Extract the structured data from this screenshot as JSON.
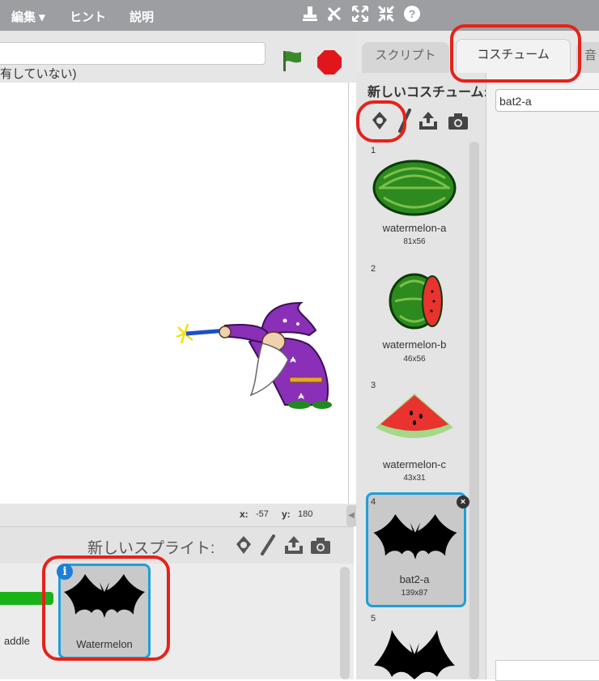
{
  "menubar": {
    "edit_label": "編集 ▾",
    "hint_label": "ヒント",
    "about_label": "説明"
  },
  "stage": {
    "sharing_note": "有していない)",
    "coords": {
      "x_label": "x:",
      "x_value": "-57",
      "y_label": "y:",
      "y_value": "180"
    }
  },
  "sprite_pane": {
    "new_sprite_label": "新しいスプライト:",
    "sprites": [
      {
        "label": "addle"
      },
      {
        "label": "Watermelon"
      }
    ]
  },
  "tabs": {
    "script": "スクリプト",
    "costume": "コスチューム",
    "sound": "音"
  },
  "costumes": {
    "new_costume_label": "新しいコスチューム:",
    "name_field_value": "bat2-a",
    "items": [
      {
        "number": "1",
        "name": "watermelon-a",
        "size": "81x56"
      },
      {
        "number": "2",
        "name": "watermelon-b",
        "size": "46x56"
      },
      {
        "number": "3",
        "name": "watermelon-c",
        "size": "43x31"
      },
      {
        "number": "4",
        "name": "bat2-a",
        "size": "139x87"
      },
      {
        "number": "5"
      }
    ]
  },
  "colors": {
    "menubar": "#9c9ea2",
    "selection_border": "#1d9fd9",
    "annotation_red": "#e5221b",
    "stop_red": "#e0161b",
    "flag_green": "#3a8a2a"
  }
}
